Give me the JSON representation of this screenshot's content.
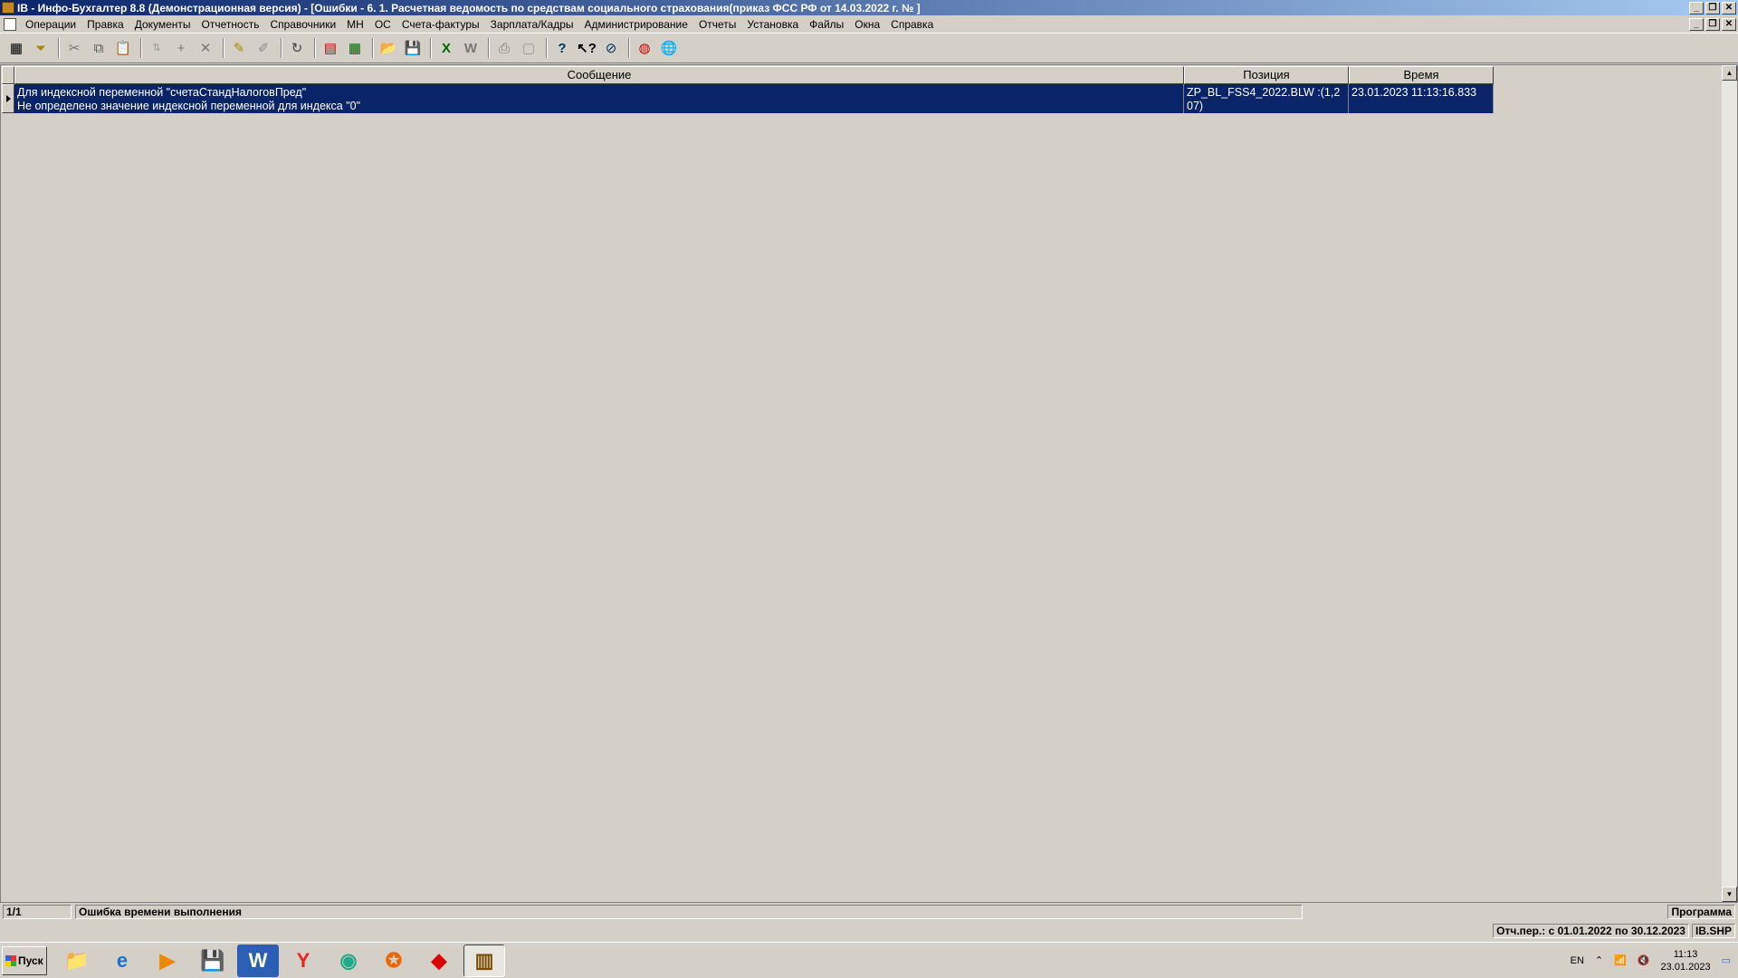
{
  "window": {
    "title": "IB - Инфо-Бухгалтер 8.8 (Демонстрационная версия) - [Ошибки - 6. 1. Расчетная ведомость по средствам социального страхования(приказ ФСС РФ от 14.03.2022 г. № ]",
    "minimize": "_",
    "restore": "❐",
    "close": "✕"
  },
  "menu": {
    "items": [
      "Операции",
      "Правка",
      "Документы",
      "Отчетность",
      "Справочники",
      "МН",
      "ОС",
      "Счета-фактуры",
      "Зарплата/Кадры",
      "Администрирование",
      "Отчеты",
      "Установка",
      "Файлы",
      "Окна",
      "Справка"
    ]
  },
  "toolbar": {
    "icons": [
      "calculator-icon",
      "filter-icon",
      "cut-icon",
      "copy-icon",
      "paste-icon",
      "sort-icon",
      "add-icon",
      "delete-icon",
      "mark-icon",
      "unmark-icon",
      "refresh-icon",
      "pdf-icon",
      "spreadsheet-icon",
      "open-folder-icon",
      "save-icon",
      "excel-icon",
      "word-icon",
      "print-icon",
      "preview-icon",
      "help-icon",
      "context-help-icon",
      "compass-icon",
      "support-icon",
      "web-icon"
    ]
  },
  "grid": {
    "columns": [
      "Сообщение",
      "Позиция",
      "Время"
    ],
    "rows": [
      {
        "message_line1": "Для индексной переменной \"счетаСтандНалоговПред\"",
        "message_line2": "Не определено значение индексной переменной для индекса \"0\"",
        "position_line1": "ZP_BL_FSS4_2022.BLW :(1,2",
        "position_line2": "07)",
        "time": "23.01.2023 11:13:16.833"
      }
    ]
  },
  "status": {
    "record_counter": "1/1",
    "error_type": "Ошибка времени выполнения",
    "right_label": "Программа",
    "period": "Отч.пер.: с 01.01.2022 по 30.12.2023",
    "file": "IB.SHP"
  },
  "taskbar": {
    "start_label": "Пуск",
    "lang": "EN",
    "time": "11:13",
    "date": "23.01.2023"
  }
}
